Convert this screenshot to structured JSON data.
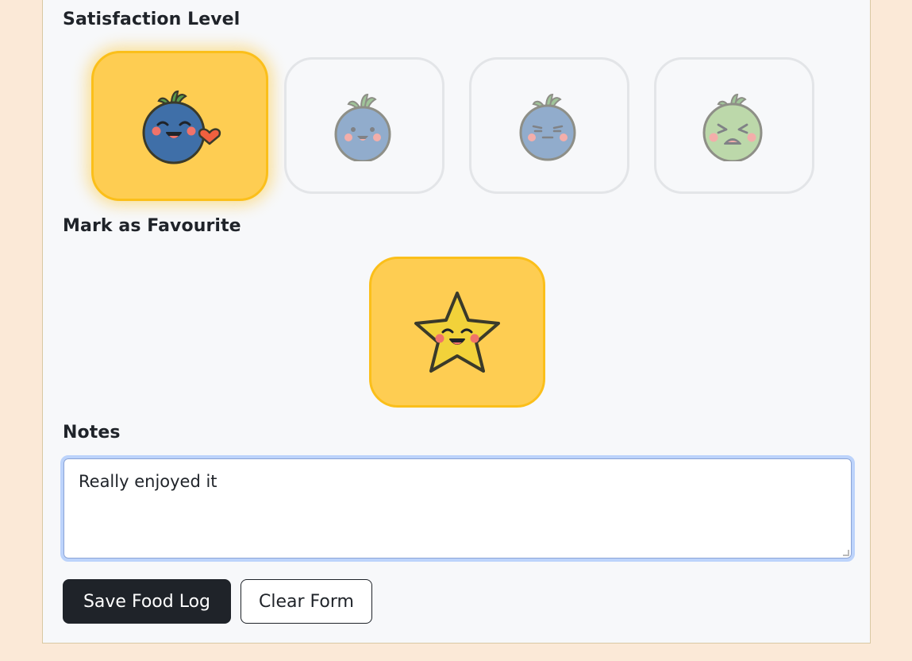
{
  "satisfaction": {
    "label": "Satisfaction Level",
    "options": [
      {
        "mood": "love",
        "selected": true
      },
      {
        "mood": "happy",
        "selected": false
      },
      {
        "mood": "neutral",
        "selected": false
      },
      {
        "mood": "disgusted",
        "selected": false
      }
    ]
  },
  "favourite": {
    "label": "Mark as Favourite",
    "selected": true
  },
  "notes": {
    "label": "Notes",
    "value": "Really enjoyed it"
  },
  "actions": {
    "save_label": "Save Food Log",
    "clear_label": "Clear Form"
  },
  "colors": {
    "selected_bg": "#fecd52",
    "selected_border": "#fbbf1a",
    "blueberry": "#3f6fa8",
    "green_fruit": "#8cbf6a",
    "leaf": "#5a9a4a",
    "cheek": "#f0736a",
    "star": "#f2d23a",
    "heart": "#f0603f",
    "primary_button": "#1f2329",
    "focus_ring": "#bcd3fb"
  },
  "icons": {
    "love": "blueberry-love-icon",
    "happy": "blueberry-happy-icon",
    "neutral": "blueberry-neutral-icon",
    "disgusted": "green-fruit-disgusted-icon",
    "favourite": "smiling-star-icon"
  }
}
